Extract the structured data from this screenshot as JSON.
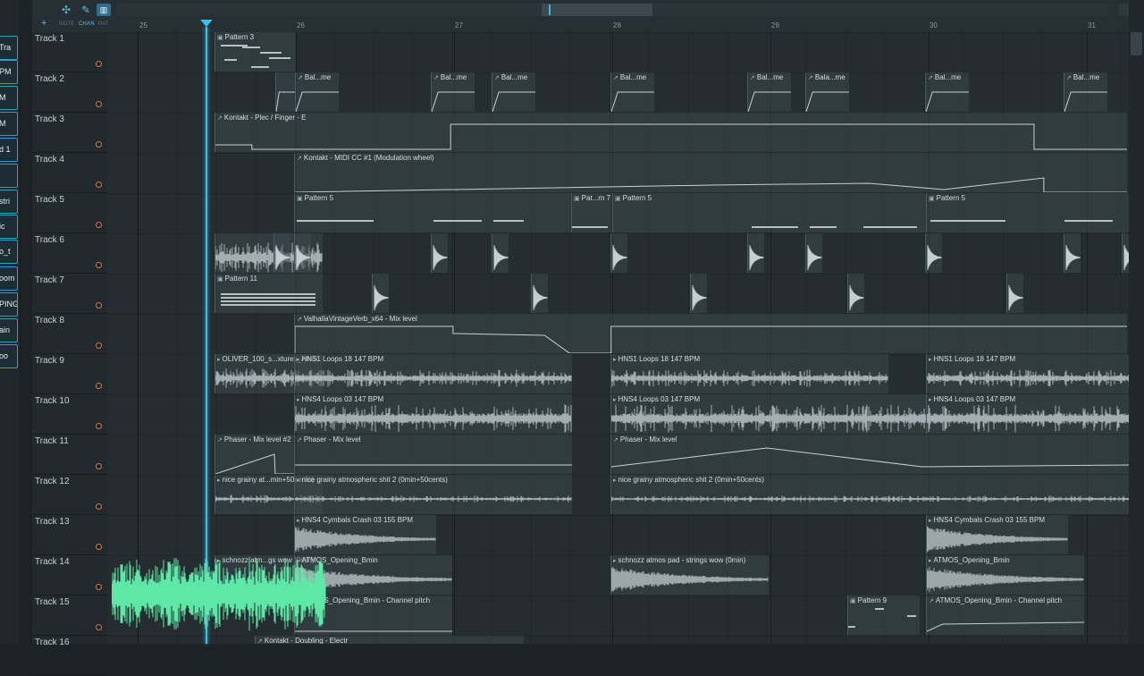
{
  "left_strip": {
    "items": [
      "Tra",
      "PM",
      "M",
      "M",
      "d 1",
      "",
      "stri",
      "ic",
      "o_t",
      "oom",
      "PING",
      "ain",
      "oo"
    ]
  },
  "toolbar": {
    "labels": [
      "NOTE",
      "CHAN",
      "PAT"
    ],
    "icons": [
      "waveform-tool-icon",
      "pencil-tool-icon",
      "piano-roll-icon"
    ],
    "add_icon": "plus-icon",
    "accent": "#3ac0ec"
  },
  "ruler": {
    "bars": [
      "25",
      "26",
      "27",
      "28",
      "29",
      "30",
      "31"
    ]
  },
  "tracks": [
    {
      "name": "Track 1"
    },
    {
      "name": "Track 2"
    },
    {
      "name": "Track 3"
    },
    {
      "name": "Track 4"
    },
    {
      "name": "Track 5"
    },
    {
      "name": "Track 6"
    },
    {
      "name": "Track 7"
    },
    {
      "name": "Track 8"
    },
    {
      "name": "Track 9"
    },
    {
      "name": "Track 10"
    },
    {
      "name": "Track 11"
    },
    {
      "name": "Track 12"
    },
    {
      "name": "Track 13"
    },
    {
      "name": "Track 14"
    },
    {
      "name": "Track 15"
    },
    {
      "name": "Track 16"
    }
  ],
  "clips": {
    "t1": [
      "Pattern 3"
    ],
    "t2": [
      "Bal...me",
      "Bal...me",
      "Bal...me",
      "Bal...me",
      "Bal...me",
      "Bal...me",
      "Bala...me",
      "Bal...me"
    ],
    "t3": [
      "Kontakt - Plec / Finger - E"
    ],
    "t4": [
      "Kontakt - MIDI CC #1 (Modulation wheel)"
    ],
    "t5": [
      "Pattern 5",
      "Pat...rn 7",
      "Pattern 5",
      "Pattern 5"
    ],
    "t7": [
      "Pattern 11"
    ],
    "t8": [
      "ValhallaVintageVerb_x64 - Mix level"
    ],
    "t9": [
      "OLIVER_100_s...xtures_Amin",
      "HNS1 Loops 18 147 BPM",
      "HNS1 Loops 18 147 BPM",
      "HNS1 Loops 18 147 BPM"
    ],
    "t10": [
      "HNS4 Loops 03 147 BPM",
      "HNS4 Loops 03 147 BPM",
      "HNS4 Loops 03 147 BPM"
    ],
    "t11": [
      "Phaser - Mix level #2",
      "Phaser - Mix level",
      "Phaser - Mix level"
    ],
    "t12": [
      "nice grainy at...min+50cents)",
      "nice grainy atmospheric shit 2 (0min+50cents)",
      "nice grainy atmospheric shit 2 (0min+50cents)"
    ],
    "t13": [
      "HNS4 Cymbals Crash 03 155 BPM",
      "HNS4 Cymbals Crash 03 155 BPM"
    ],
    "t14": [
      "schnozz atm...gs wow (0min)",
      "ATMOS_Opening_Bmin",
      "schnozz atmos pad - strings wow (0min)",
      "ATMOS_Opening_Bmin"
    ],
    "t15": [
      "ATMOS_Opening_Bmin - Channel pitch",
      "Pattern 9",
      "ATMOS_Opening_Bmin - Channel pitch"
    ],
    "t16": [
      "Kontakt - Doubling - Electr"
    ]
  },
  "colors": {
    "record_dot": "#e0763a",
    "playhead": "#3ac0ec",
    "drag_wave": "#5ee8a8",
    "wave": "#b9c2c6"
  }
}
